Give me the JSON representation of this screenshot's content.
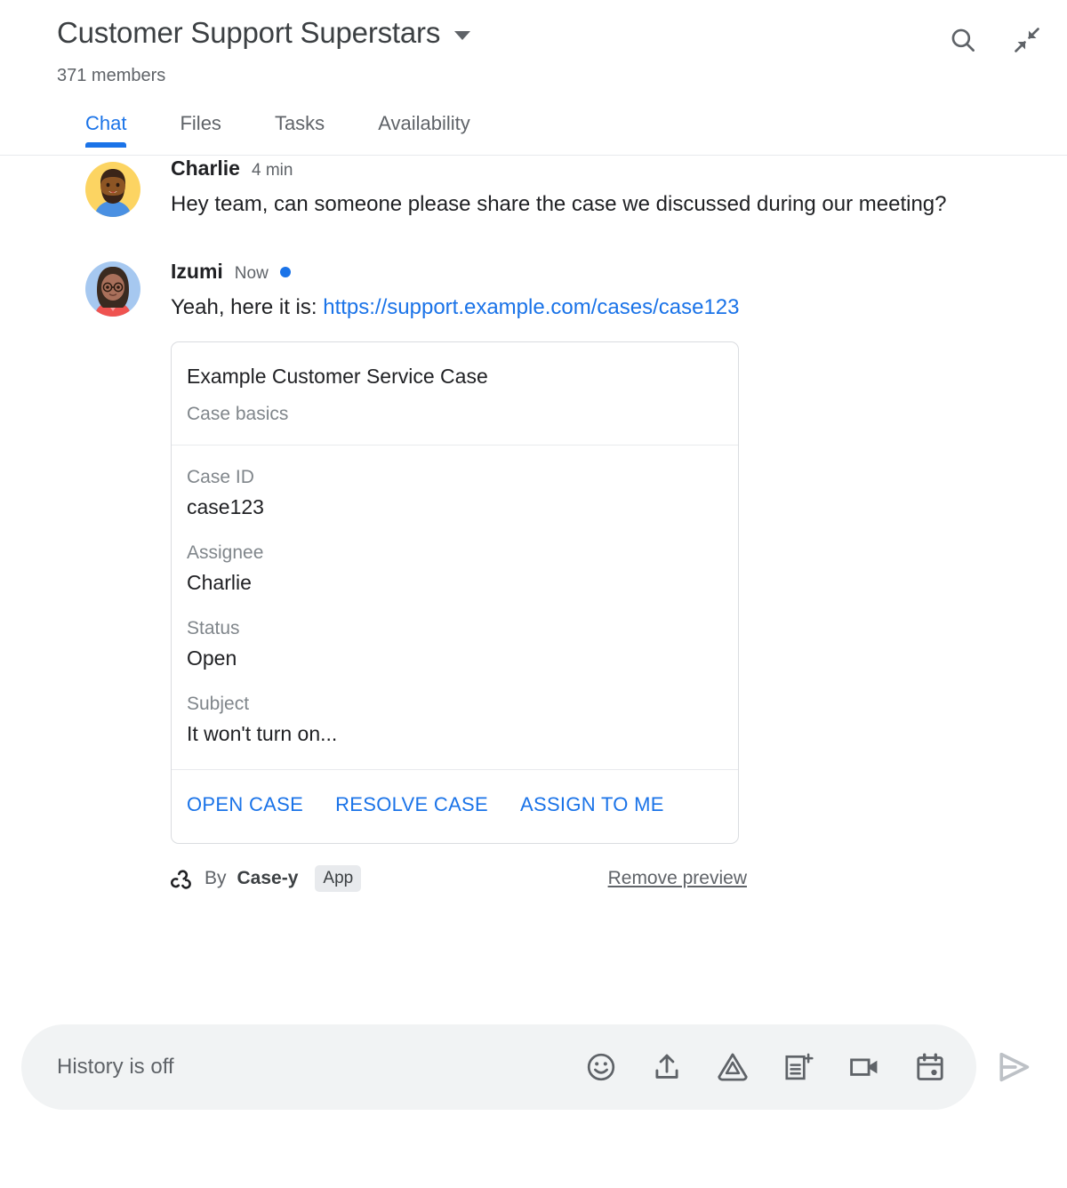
{
  "header": {
    "room_title": "Customer Support Superstars",
    "member_count": "371 members",
    "dropdown_icon": "chevron-down-icon",
    "search_icon": "search-icon",
    "collapse_icon": "collapse-arrows-icon"
  },
  "tabs": [
    {
      "label": "Chat",
      "active": true
    },
    {
      "label": "Files",
      "active": false
    },
    {
      "label": "Tasks",
      "active": false
    },
    {
      "label": "Availability",
      "active": false
    }
  ],
  "messages": [
    {
      "author": "Charlie",
      "time": "4 min",
      "unread": false,
      "text": "Hey team, can someone please share the case we discussed during our meeting?"
    },
    {
      "author": "Izumi",
      "time": "Now",
      "unread": true,
      "text_prefix": "Yeah, here it is: ",
      "link_text": "https://support.example.com/cases/case123"
    }
  ],
  "card": {
    "title": "Example Customer Service Case",
    "subtitle": "Case basics",
    "fields": [
      {
        "label": "Case ID",
        "value": "case123"
      },
      {
        "label": "Assignee",
        "value": "Charlie"
      },
      {
        "label": "Status",
        "value": "Open"
      },
      {
        "label": "Subject",
        "value": "It won't turn on..."
      }
    ],
    "actions": [
      {
        "label": "OPEN CASE"
      },
      {
        "label": "RESOLVE CASE"
      },
      {
        "label": "ASSIGN TO ME"
      }
    ]
  },
  "attribution": {
    "icon": "webhook-icon",
    "by_text": "By",
    "app_name": "Case-y",
    "badge": "App",
    "remove_preview": "Remove preview"
  },
  "compose": {
    "placeholder": "History is off",
    "icons": [
      "emoji-icon",
      "upload-icon",
      "drive-icon",
      "new-document-icon",
      "video-call-icon",
      "calendar-icon"
    ],
    "send_icon": "send-icon"
  },
  "colors": {
    "accent": "#1a73e8",
    "text_primary": "#202124",
    "text_secondary": "#5f6368",
    "text_tertiary": "#80868b",
    "border": "#dadce0",
    "compose_bg": "#f1f3f4",
    "badge_bg": "#e8eaed",
    "send_disabled": "#bdc1c6"
  }
}
